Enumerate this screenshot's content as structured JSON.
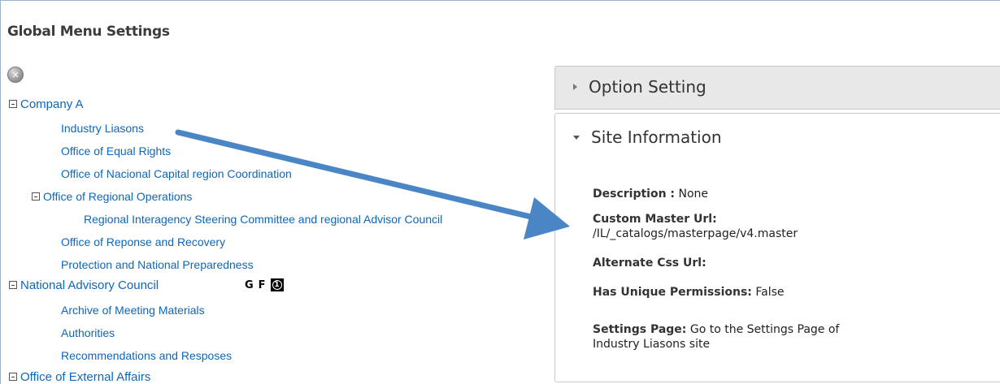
{
  "page": {
    "title": "Global Menu Settings"
  },
  "tree": {
    "nodes": [
      {
        "label": "Company A",
        "level": 1,
        "expanded": true
      },
      {
        "label": "Industry Liasons",
        "level": 2
      },
      {
        "label": "Office of Equal Rights",
        "level": 2
      },
      {
        "label": "Office of Nacional Capital region Coordination",
        "level": 2
      },
      {
        "label": "Office of Regional Operations",
        "level": 2,
        "expanded": true
      },
      {
        "label": "Regional Interagency Steering Committee and regional Advisor Council",
        "level": 3
      },
      {
        "label": "Office of Reponse and Recovery",
        "level": 2
      },
      {
        "label": "Protection and National Preparedness",
        "level": 2
      },
      {
        "label": "National Advisory Council",
        "level": 1,
        "expanded": true
      },
      {
        "label": "Archive of Meeting Materials",
        "level": 2
      },
      {
        "label": "Authorities",
        "level": 2
      },
      {
        "label": "Recommendations and Resposes",
        "level": 2
      },
      {
        "label": "Office of External Affairs",
        "level": 1,
        "expanded": true
      }
    ],
    "badges": {
      "letter_g": "G",
      "letter_f": "F",
      "count": "1"
    }
  },
  "panels": {
    "option_setting": {
      "title": "Option Setting"
    },
    "site_information": {
      "title": "Site Information",
      "description_label": "Description :",
      "description_value": "None",
      "custom_master_label": "Custom Master Url:",
      "custom_master_value": "/IL/_catalogs/masterpage/v4.master",
      "alternate_css_label": "Alternate Css Url:",
      "unique_perm_label": "Has Unique Permissions:",
      "unique_perm_value": "False",
      "settings_page_label": "Settings Page:",
      "settings_page_value_line1": "Go to the Settings Page of",
      "settings_page_value_line2": "Industry Liasons site"
    }
  },
  "colors": {
    "link": "#0f66b8",
    "arrow": "#4a86c6",
    "panel_header_bg": "#e8e8e8"
  },
  "icons": {
    "tools": "wrench-screwdriver-icon",
    "collapse": "minus-box-icon"
  }
}
